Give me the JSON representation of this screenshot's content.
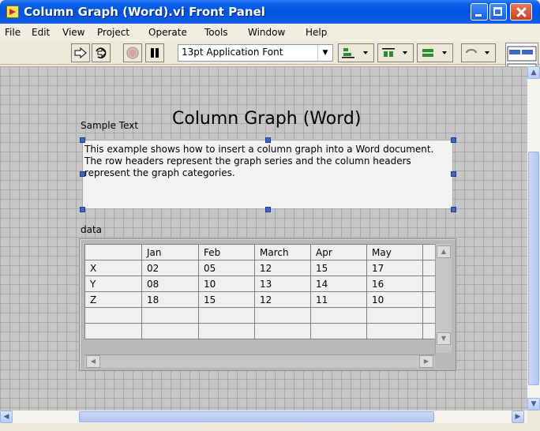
{
  "window": {
    "title": "Column Graph (Word).vi Front Panel"
  },
  "menu": [
    {
      "label": "File"
    },
    {
      "label": "Edit"
    },
    {
      "label": "View"
    },
    {
      "label": "Project"
    },
    {
      "label": "Operate"
    },
    {
      "label": "Tools"
    },
    {
      "label": "Window"
    },
    {
      "label": "Help"
    }
  ],
  "toolbar": {
    "run_icon": "run-arrow-icon",
    "run_continuous_icon": "run-continuously-icon",
    "abort_icon": "abort-icon",
    "pause_icon": "pause-icon",
    "font_value": "13pt Application Font",
    "align_icon": "align-objects-icon",
    "distribute_icon": "distribute-objects-icon",
    "resize_icon": "resize-objects-icon",
    "reorder_icon": "reorder-icon"
  },
  "panel": {
    "title": "Column Graph (Word)",
    "sample_text": {
      "label": "Sample Text",
      "value": "This example shows how to insert a column graph into a Word document. The row headers represent the graph series and the column headers represent the graph categories."
    },
    "data": {
      "label": "data",
      "columns": [
        "",
        "Jan",
        "Feb",
        "March",
        "Apr",
        "May",
        ""
      ],
      "rows": [
        [
          "X",
          "02",
          "05",
          "12",
          "15",
          "17",
          ""
        ],
        [
          "Y",
          "08",
          "10",
          "13",
          "14",
          "16",
          ""
        ],
        [
          "Z",
          "18",
          "15",
          "12",
          "11",
          "10",
          ""
        ],
        [
          "",
          "",
          "",
          "",
          "",
          "",
          ""
        ],
        [
          "",
          "",
          "",
          "",
          "",
          "",
          ""
        ]
      ]
    }
  },
  "colors": {
    "titlebar": "#0A5FEA",
    "panel_background": "#C6C6C6",
    "grid": "#A9A9A9",
    "selection_handle": "#3B67C9"
  }
}
